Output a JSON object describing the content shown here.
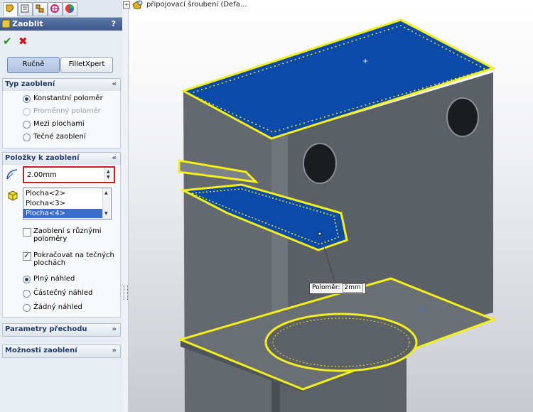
{
  "panel": {
    "tabs": [
      {
        "name": "feature-manager-icon",
        "active": true
      },
      {
        "name": "property-manager-icon",
        "active": false
      },
      {
        "name": "configuration-manager-icon",
        "active": false
      },
      {
        "name": "dimxpert-icon",
        "active": false
      },
      {
        "name": "display-manager-icon",
        "active": false
      }
    ],
    "title": "Zaoblit",
    "help": "?",
    "ok_icon": "check-icon",
    "cancel_icon": "x-icon",
    "mode_buttons": {
      "manual": "Ručně",
      "filletxpert": "FilletXpert"
    },
    "fillet_type": {
      "header": "Typ zaoblení",
      "options": [
        "Konstantní poloměr",
        "Proměnný poloměr",
        "Mezi plochami",
        "Tečné zaoblení"
      ],
      "selected": "Konstantní poloměr",
      "disabled": [
        "Proměnný poloměr"
      ]
    },
    "items_to_fillet": {
      "header": "Položky k zaoblení",
      "radius_value": "2.00mm",
      "faces": [
        "Plocha<2>",
        "Plocha<3>",
        "Plocha<4>"
      ],
      "selected_face": "Plocha<4>",
      "checkboxes": [
        {
          "label": "Zaoblení s různými poloměry",
          "checked": false
        },
        {
          "label": "Pokračovat na tečných plochách",
          "checked": true
        }
      ],
      "preview": [
        "Plný náhled",
        "Částečný náhled",
        "Žádný náhled"
      ],
      "preview_selected": "Plný náhled"
    },
    "collapsed_sections": [
      "Parametry přechodu",
      "Možnosti zaoblení"
    ]
  },
  "viewport": {
    "tree_label": "připojovací šroubení  (Defa...",
    "callout_label": "Poloměr:",
    "callout_value": "2mm",
    "colors": {
      "face_selected": "#0b4aa8",
      "part": "#5d6269",
      "highlight": "#f2ef1a"
    }
  }
}
